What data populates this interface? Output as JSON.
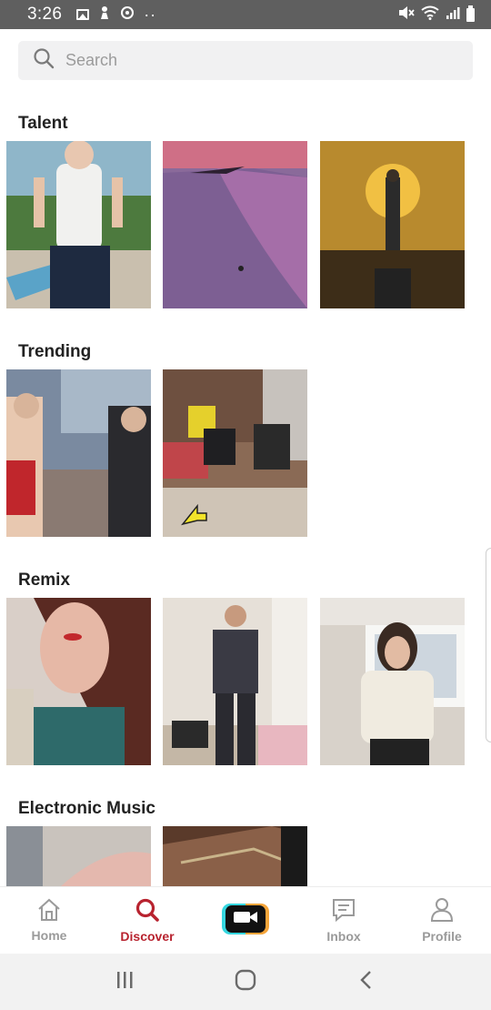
{
  "status_bar": {
    "time": "3:26",
    "left_icons": [
      "image-icon",
      "android-debug-icon",
      "sync-icon",
      "more-dots-icon"
    ],
    "right_icons": [
      "mute-icon",
      "wifi-icon",
      "signal-icon",
      "battery-icon"
    ]
  },
  "search": {
    "placeholder": "Search"
  },
  "sections": [
    {
      "title": "Talent",
      "thumbnail_count": 3
    },
    {
      "title": "Trending",
      "thumbnail_count": 2
    },
    {
      "title": "Remix",
      "thumbnail_count": 3
    },
    {
      "title": "Electronic Music",
      "thumbnail_count": 2
    }
  ],
  "bottom_nav": {
    "items": [
      {
        "label": "Home",
        "icon": "home-icon",
        "active": false
      },
      {
        "label": "Discover",
        "icon": "search-icon",
        "active": true
      },
      {
        "label": "",
        "icon": "video-camera-icon",
        "active": false
      },
      {
        "label": "Inbox",
        "icon": "chat-icon",
        "active": false
      },
      {
        "label": "Profile",
        "icon": "person-icon",
        "active": false
      }
    ]
  },
  "colors": {
    "accent": "#b8232f",
    "inactive": "#9a9a9a",
    "status_bar": "#5f5f5f",
    "search_bg": "#f1f1f2",
    "record_left": "#35d7e0",
    "record_right": "#f5a53a"
  },
  "system_nav": {
    "buttons": [
      "recent-apps-icon",
      "home-circle-icon",
      "back-chevron-icon"
    ]
  }
}
